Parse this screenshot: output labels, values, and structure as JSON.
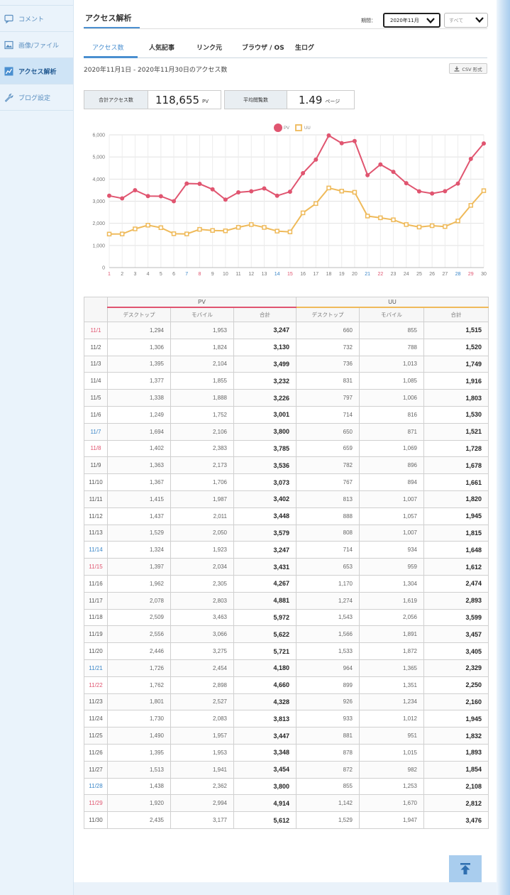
{
  "sidebar": {
    "items": [
      {
        "label": "コメント",
        "icon": "comment-icon"
      },
      {
        "label": "画像/ファイル",
        "icon": "image-icon"
      },
      {
        "label": "アクセス解析",
        "icon": "analytics-icon",
        "active": true
      },
      {
        "label": "ブログ設定",
        "icon": "wrench-icon"
      }
    ]
  },
  "header": {
    "title": "アクセス解析",
    "period_label": "期間：",
    "period_value": "2020年11月",
    "device_value": "すべて"
  },
  "tabs": [
    {
      "label": "アクセス数",
      "active": true
    },
    {
      "label": "人気記事"
    },
    {
      "label": "リンク元"
    },
    {
      "label": "ブラウザ / OS"
    },
    {
      "label": "生ログ"
    }
  ],
  "summary": {
    "range_text": "2020年11月1日 - 2020年11月30日のアクセス数",
    "csv_label": "CSV 形式",
    "total_label": "合計アクセス数",
    "total_value": "118,655",
    "total_unit": "PV",
    "avg_label": "平均閲覧数",
    "avg_value": "1.49",
    "avg_unit": "ページ"
  },
  "colors": {
    "pv": "#e05570",
    "uu": "#efba5a",
    "accent": "#4a8fd0",
    "saturday": "#3a86c8",
    "sunday": "#e05570"
  },
  "chart_data": {
    "type": "line",
    "x": [
      1,
      2,
      3,
      4,
      5,
      6,
      7,
      8,
      9,
      10,
      11,
      12,
      13,
      14,
      15,
      16,
      17,
      18,
      19,
      20,
      21,
      22,
      23,
      24,
      25,
      26,
      27,
      28,
      29,
      30
    ],
    "series": [
      {
        "name": "PV",
        "values": [
          3247,
          3130,
          3499,
          3232,
          3226,
          3001,
          3800,
          3785,
          3536,
          3073,
          3402,
          3448,
          3579,
          3247,
          3431,
          4267,
          4881,
          5972,
          5622,
          5721,
          4180,
          4660,
          4328,
          3813,
          3447,
          3348,
          3454,
          3800,
          4914,
          5612
        ]
      },
      {
        "name": "UU",
        "values": [
          1515,
          1520,
          1749,
          1916,
          1803,
          1530,
          1521,
          1728,
          1678,
          1661,
          1820,
          1945,
          1815,
          1648,
          1612,
          2474,
          2893,
          3599,
          3457,
          3405,
          2329,
          2250,
          2160,
          1945,
          1832,
          1893,
          1854,
          2108,
          2812,
          3476
        ]
      }
    ],
    "ylim": [
      0,
      6000
    ],
    "yticks": [
      "0",
      "1,000",
      "2,000",
      "3,000",
      "4,000",
      "5,000",
      "6,000"
    ],
    "saturdays": [
      7,
      14,
      21,
      28
    ],
    "sundays": [
      1,
      8,
      15,
      22,
      29
    ],
    "legend": "top-center",
    "grid": true
  },
  "table": {
    "group_pv": "PV",
    "group_uu": "UU",
    "sub_headers": [
      "デスクトップ",
      "モバイル",
      "合計",
      "デスクトップ",
      "モバイル",
      "合計"
    ],
    "rows": [
      {
        "date": "11/1",
        "day": "sun",
        "pv_d": "1,294",
        "pv_m": "1,953",
        "pv_t": "3,247",
        "uu_d": "660",
        "uu_m": "855",
        "uu_t": "1,515"
      },
      {
        "date": "11/2",
        "day": "",
        "pv_d": "1,306",
        "pv_m": "1,824",
        "pv_t": "3,130",
        "uu_d": "732",
        "uu_m": "788",
        "uu_t": "1,520"
      },
      {
        "date": "11/3",
        "day": "",
        "pv_d": "1,395",
        "pv_m": "2,104",
        "pv_t": "3,499",
        "uu_d": "736",
        "uu_m": "1,013",
        "uu_t": "1,749"
      },
      {
        "date": "11/4",
        "day": "",
        "pv_d": "1,377",
        "pv_m": "1,855",
        "pv_t": "3,232",
        "uu_d": "831",
        "uu_m": "1,085",
        "uu_t": "1,916"
      },
      {
        "date": "11/5",
        "day": "",
        "pv_d": "1,338",
        "pv_m": "1,888",
        "pv_t": "3,226",
        "uu_d": "797",
        "uu_m": "1,006",
        "uu_t": "1,803"
      },
      {
        "date": "11/6",
        "day": "",
        "pv_d": "1,249",
        "pv_m": "1,752",
        "pv_t": "3,001",
        "uu_d": "714",
        "uu_m": "816",
        "uu_t": "1,530"
      },
      {
        "date": "11/7",
        "day": "sat",
        "pv_d": "1,694",
        "pv_m": "2,106",
        "pv_t": "3,800",
        "uu_d": "650",
        "uu_m": "871",
        "uu_t": "1,521"
      },
      {
        "date": "11/8",
        "day": "sun",
        "pv_d": "1,402",
        "pv_m": "2,383",
        "pv_t": "3,785",
        "uu_d": "659",
        "uu_m": "1,069",
        "uu_t": "1,728"
      },
      {
        "date": "11/9",
        "day": "",
        "pv_d": "1,363",
        "pv_m": "2,173",
        "pv_t": "3,536",
        "uu_d": "782",
        "uu_m": "896",
        "uu_t": "1,678"
      },
      {
        "date": "11/10",
        "day": "",
        "pv_d": "1,367",
        "pv_m": "1,706",
        "pv_t": "3,073",
        "uu_d": "767",
        "uu_m": "894",
        "uu_t": "1,661"
      },
      {
        "date": "11/11",
        "day": "",
        "pv_d": "1,415",
        "pv_m": "1,987",
        "pv_t": "3,402",
        "uu_d": "813",
        "uu_m": "1,007",
        "uu_t": "1,820"
      },
      {
        "date": "11/12",
        "day": "",
        "pv_d": "1,437",
        "pv_m": "2,011",
        "pv_t": "3,448",
        "uu_d": "888",
        "uu_m": "1,057",
        "uu_t": "1,945"
      },
      {
        "date": "11/13",
        "day": "",
        "pv_d": "1,529",
        "pv_m": "2,050",
        "pv_t": "3,579",
        "uu_d": "808",
        "uu_m": "1,007",
        "uu_t": "1,815"
      },
      {
        "date": "11/14",
        "day": "sat",
        "pv_d": "1,324",
        "pv_m": "1,923",
        "pv_t": "3,247",
        "uu_d": "714",
        "uu_m": "934",
        "uu_t": "1,648"
      },
      {
        "date": "11/15",
        "day": "sun",
        "pv_d": "1,397",
        "pv_m": "2,034",
        "pv_t": "3,431",
        "uu_d": "653",
        "uu_m": "959",
        "uu_t": "1,612"
      },
      {
        "date": "11/16",
        "day": "",
        "pv_d": "1,962",
        "pv_m": "2,305",
        "pv_t": "4,267",
        "uu_d": "1,170",
        "uu_m": "1,304",
        "uu_t": "2,474"
      },
      {
        "date": "11/17",
        "day": "",
        "pv_d": "2,078",
        "pv_m": "2,803",
        "pv_t": "4,881",
        "uu_d": "1,274",
        "uu_m": "1,619",
        "uu_t": "2,893"
      },
      {
        "date": "11/18",
        "day": "",
        "pv_d": "2,509",
        "pv_m": "3,463",
        "pv_t": "5,972",
        "uu_d": "1,543",
        "uu_m": "2,056",
        "uu_t": "3,599"
      },
      {
        "date": "11/19",
        "day": "",
        "pv_d": "2,556",
        "pv_m": "3,066",
        "pv_t": "5,622",
        "uu_d": "1,566",
        "uu_m": "1,891",
        "uu_t": "3,457"
      },
      {
        "date": "11/20",
        "day": "",
        "pv_d": "2,446",
        "pv_m": "3,275",
        "pv_t": "5,721",
        "uu_d": "1,533",
        "uu_m": "1,872",
        "uu_t": "3,405"
      },
      {
        "date": "11/21",
        "day": "sat",
        "pv_d": "1,726",
        "pv_m": "2,454",
        "pv_t": "4,180",
        "uu_d": "964",
        "uu_m": "1,365",
        "uu_t": "2,329"
      },
      {
        "date": "11/22",
        "day": "sun",
        "pv_d": "1,762",
        "pv_m": "2,898",
        "pv_t": "4,660",
        "uu_d": "899",
        "uu_m": "1,351",
        "uu_t": "2,250"
      },
      {
        "date": "11/23",
        "day": "",
        "pv_d": "1,801",
        "pv_m": "2,527",
        "pv_t": "4,328",
        "uu_d": "926",
        "uu_m": "1,234",
        "uu_t": "2,160"
      },
      {
        "date": "11/24",
        "day": "",
        "pv_d": "1,730",
        "pv_m": "2,083",
        "pv_t": "3,813",
        "uu_d": "933",
        "uu_m": "1,012",
        "uu_t": "1,945"
      },
      {
        "date": "11/25",
        "day": "",
        "pv_d": "1,490",
        "pv_m": "1,957",
        "pv_t": "3,447",
        "uu_d": "881",
        "uu_m": "951",
        "uu_t": "1,832"
      },
      {
        "date": "11/26",
        "day": "",
        "pv_d": "1,395",
        "pv_m": "1,953",
        "pv_t": "3,348",
        "uu_d": "878",
        "uu_m": "1,015",
        "uu_t": "1,893"
      },
      {
        "date": "11/27",
        "day": "",
        "pv_d": "1,513",
        "pv_m": "1,941",
        "pv_t": "3,454",
        "uu_d": "872",
        "uu_m": "982",
        "uu_t": "1,854"
      },
      {
        "date": "11/28",
        "day": "sat",
        "pv_d": "1,438",
        "pv_m": "2,362",
        "pv_t": "3,800",
        "uu_d": "855",
        "uu_m": "1,253",
        "uu_t": "2,108"
      },
      {
        "date": "11/29",
        "day": "sun",
        "pv_d": "1,920",
        "pv_m": "2,994",
        "pv_t": "4,914",
        "uu_d": "1,142",
        "uu_m": "1,670",
        "uu_t": "2,812"
      },
      {
        "date": "11/30",
        "day": "",
        "pv_d": "2,435",
        "pv_m": "3,177",
        "pv_t": "5,612",
        "uu_d": "1,529",
        "uu_m": "1,947",
        "uu_t": "3,476"
      }
    ]
  }
}
